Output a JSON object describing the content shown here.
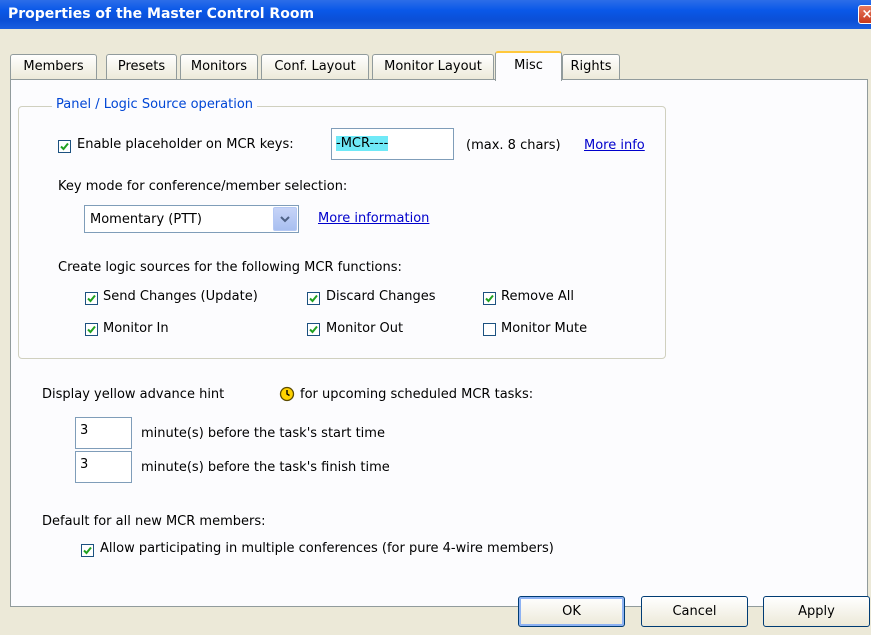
{
  "window": {
    "title": "Properties of the Master Control Room",
    "close_glyph": "×"
  },
  "tabs": [
    "Members",
    "Presets",
    "Monitors",
    "Conf. Layout",
    "Monitor Layout",
    "Misc",
    "Rights"
  ],
  "active_tab": "Misc",
  "panel": {
    "group_title": "Panel / Logic Source operation",
    "placeholder": {
      "checked": true,
      "label": "Enable placeholder on MCR keys:",
      "value": "-MCR----",
      "hint": "(max. 8 chars)",
      "more_info": "More info"
    },
    "key_mode": {
      "label": "Key mode for conference/member selection:",
      "selected": "Momentary (PTT)",
      "more_info": "More information"
    },
    "logic_sources": {
      "label": "Create logic sources for the following MCR functions:",
      "items": [
        {
          "label": "Send Changes (Update)",
          "checked": true
        },
        {
          "label": "Discard Changes",
          "checked": true
        },
        {
          "label": "Remove All",
          "checked": true
        },
        {
          "label": "Monitor In",
          "checked": true
        },
        {
          "label": "Monitor Out",
          "checked": true
        },
        {
          "label": "Monitor Mute",
          "checked": false
        }
      ]
    },
    "hint": {
      "label_pre": "Display yellow advance hint",
      "label_post": "for upcoming scheduled MCR tasks:",
      "icon": "clock-icon",
      "start_value": "3",
      "start_label": "minute(s) before the task's start time",
      "finish_value": "3",
      "finish_label": "minute(s) before the task's finish time"
    },
    "defaults": {
      "label": "Default for all new MCR members:",
      "allow_multi": {
        "label": "Allow participating in multiple conferences (for pure 4-wire members)",
        "checked": true
      }
    }
  },
  "buttons": {
    "ok": "OK",
    "cancel": "Cancel",
    "apply": "Apply"
  },
  "colors": {
    "title_bar": "#0b4fd6",
    "link": "#0000cc",
    "group_title": "#0046d5",
    "highlight": "#6fe9f7",
    "hint_icon": "#ffd200"
  }
}
